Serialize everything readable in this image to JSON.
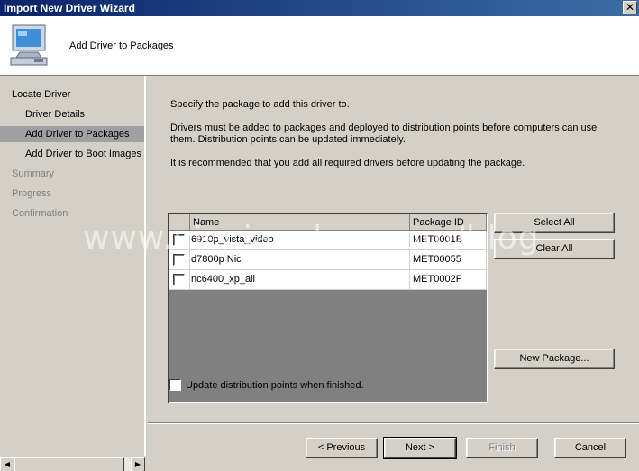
{
  "window": {
    "title": "Import New Driver Wizard",
    "close_label": "✕"
  },
  "header": {
    "title": "Add Driver to Packages",
    "icon": "computer-icon"
  },
  "nav": {
    "items": [
      {
        "label": "Locate Driver",
        "state": "done"
      },
      {
        "label": "Driver Details",
        "state": "done"
      },
      {
        "label": "Add Driver to Packages",
        "state": "active"
      },
      {
        "label": "Add Driver to Boot Images",
        "state": "done"
      },
      {
        "label": "Summary",
        "state": "pending"
      },
      {
        "label": "Progress",
        "state": "pending"
      },
      {
        "label": "Confirmation",
        "state": "pending"
      }
    ]
  },
  "content": {
    "intro": "Specify the package to add this driver to.",
    "desc_line1": "Drivers must be added to packages and deployed to distribution points before computers can use",
    "desc_line2": "them.  Distribution points can be updated immediately.",
    "recommend": "It is recommended that you add all required drivers before updating the package."
  },
  "grid": {
    "columns": [
      "Name",
      "Package ID"
    ],
    "rows": [
      {
        "name": "6910p_vista_video",
        "package_id": "MET0001B",
        "checked": false
      },
      {
        "name": "d7800p Nic",
        "package_id": "MET00055",
        "checked": false
      },
      {
        "name": "nc6400_xp_all",
        "package_id": "MET0002F",
        "checked": false
      }
    ]
  },
  "buttons": {
    "select_all": "Select All",
    "clear_all": "Clear All",
    "new_package": "New Package...",
    "previous": "< Previous",
    "next": "Next >",
    "finish": "Finish",
    "cancel": "Cancel"
  },
  "update_option": {
    "label": "Update distribution points when finished.",
    "checked": false
  },
  "watermark": "www.vieciauskas.com/blog"
}
